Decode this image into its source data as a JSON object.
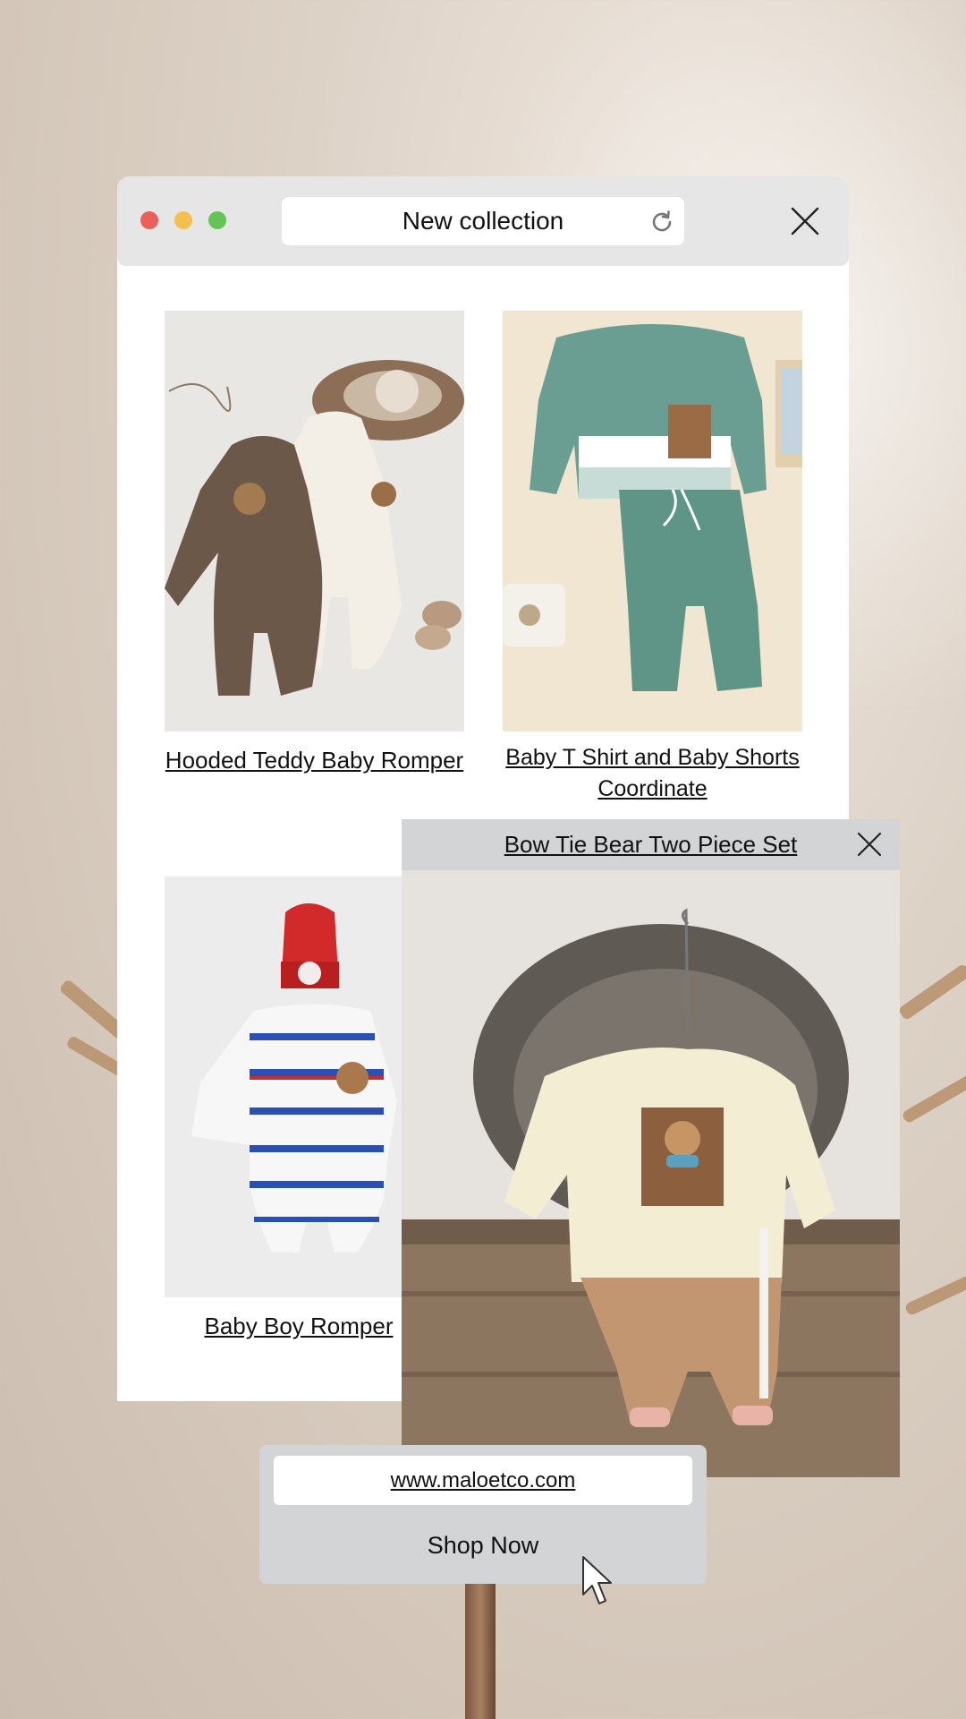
{
  "window": {
    "title": "New collection",
    "icons": {
      "reload": "reload-icon",
      "close": "close-icon"
    },
    "traffic_lights": [
      "#ec5f5b",
      "#f5bf4f",
      "#62c554"
    ]
  },
  "products": [
    {
      "name": "Hooded Teddy Baby Romper"
    },
    {
      "name": "Baby T Shirt and Baby Shorts Coordinate"
    },
    {
      "name": "Baby Boy Romper"
    }
  ],
  "popup": {
    "title": "Bow Tie Bear Two Piece Set",
    "close_icon": "close-icon"
  },
  "shop": {
    "url": "www.maloetco.com",
    "button_label": "Shop Now"
  },
  "colors": {
    "titlebar": "#e6e6e6",
    "panel": "#d3d4d6"
  }
}
